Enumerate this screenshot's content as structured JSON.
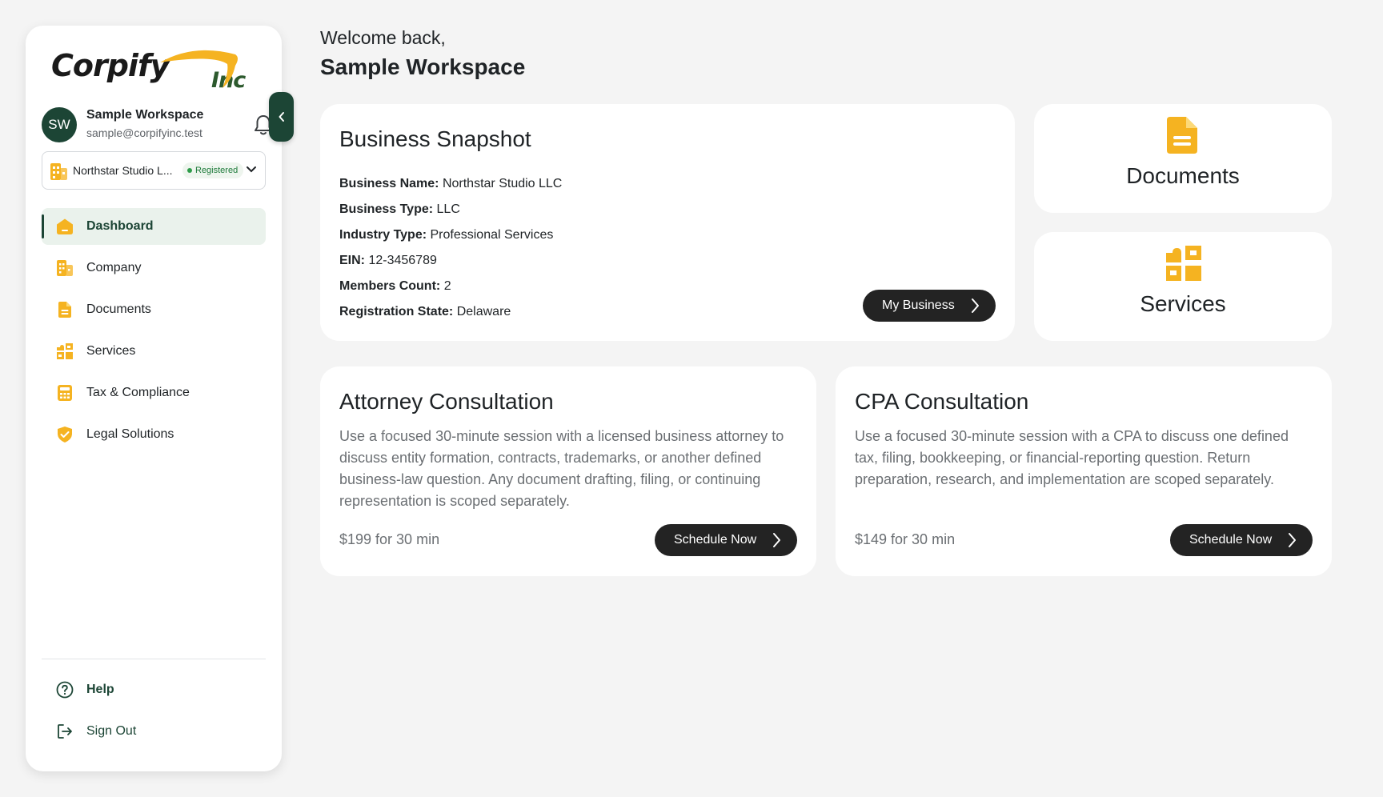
{
  "sidebar": {
    "logo": {
      "main": "Corpify",
      "suffix": "Inc"
    },
    "user": {
      "initials": "SW",
      "name": "Sample Workspace",
      "email": "sample@corpifyinc.test"
    },
    "company": {
      "name": "Northstar Studio L...",
      "status": "Registered"
    },
    "nav": [
      {
        "label": "Dashboard",
        "icon": "home-icon",
        "active": true
      },
      {
        "label": "Company",
        "icon": "building-icon",
        "active": false
      },
      {
        "label": "Documents",
        "icon": "document-icon",
        "active": false
      },
      {
        "label": "Services",
        "icon": "puzzle-icon",
        "active": false
      },
      {
        "label": "Tax & Compliance",
        "icon": "calculator-icon",
        "active": false
      },
      {
        "label": "Legal Solutions",
        "icon": "shield-check-icon",
        "active": false
      }
    ],
    "help_label": "Help",
    "signout_label": "Sign Out"
  },
  "header": {
    "welcome": "Welcome back,",
    "workspace": "Sample Workspace"
  },
  "snapshot": {
    "title": "Business Snapshot",
    "fields": [
      {
        "label": "Business Name:",
        "value": "Northstar Studio LLC"
      },
      {
        "label": "Business Type:",
        "value": "LLC"
      },
      {
        "label": "Industry Type:",
        "value": "Professional Services"
      },
      {
        "label": "EIN:",
        "value": "12-3456789"
      },
      {
        "label": "Members Count:",
        "value": "2"
      },
      {
        "label": "Registration State:",
        "value": "Delaware"
      }
    ],
    "button": "My Business"
  },
  "tiles": {
    "documents": "Documents",
    "services": "Services"
  },
  "consultations": [
    {
      "title": "Attorney Consultation",
      "description": "Use a focused 30-minute session with a licensed business attorney to discuss entity formation, contracts, trademarks, or another defined business-law question. Any document drafting, filing, or continuing representation is scoped separately.",
      "price": "$199 for 30 min",
      "button": "Schedule Now"
    },
    {
      "title": "CPA Consultation",
      "description": "Use a focused 30-minute session with a CPA to discuss one defined tax, filing, bookkeeping, or financial-reporting question. Return preparation, research, and implementation are scoped separately.",
      "price": "$149 for 30 min",
      "button": "Schedule Now"
    }
  ],
  "colors": {
    "accent": "#F5B321",
    "brand_dark": "#1C4535",
    "button_dark": "#232323",
    "background": "#F4F4F4"
  }
}
